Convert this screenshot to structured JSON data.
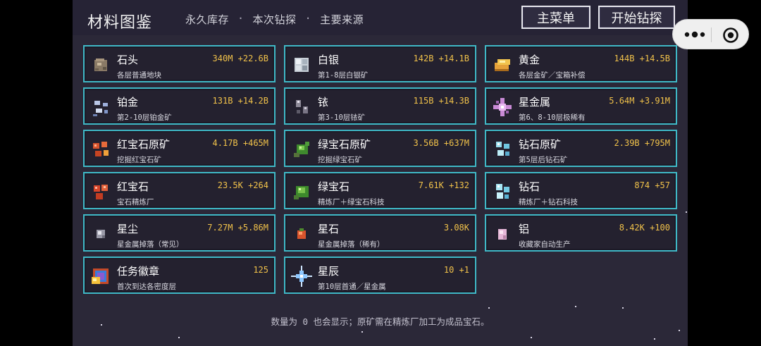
{
  "header": {
    "title": "材料图鉴",
    "tabs": [
      "永久库存",
      "本次钻探",
      "主要来源"
    ],
    "separator": "·",
    "main_menu_label": "主菜单",
    "start_drill_label": "开始钻探"
  },
  "materials": [
    {
      "name": "石头",
      "source": "各层普通地块",
      "value": "340M +22.6B",
      "icon": "stone-icon"
    },
    {
      "name": "白银",
      "source": "第1-8层白银矿",
      "value": "142B +14.1B",
      "icon": "silver-icon"
    },
    {
      "name": "黄金",
      "source": "各层金矿／宝箱补偿",
      "value": "144B +14.5B",
      "icon": "gold-icon"
    },
    {
      "name": "铂金",
      "source": "第2-10层铂金矿",
      "value": "131B +14.2B",
      "icon": "platinum-icon"
    },
    {
      "name": "铱",
      "source": "第3-10层铱矿",
      "value": "115B +14.3B",
      "icon": "iridium-icon"
    },
    {
      "name": "星金属",
      "source": "第6、8-10层极稀有",
      "value": "5.64M +3.91M",
      "icon": "star-metal-icon"
    },
    {
      "name": "红宝石原矿",
      "source": "挖掘红宝石矿",
      "value": "4.17B +465M",
      "icon": "ruby-ore-icon"
    },
    {
      "name": "绿宝石原矿",
      "source": "挖掘绿宝石矿",
      "value": "3.56B +637M",
      "icon": "emerald-ore-icon"
    },
    {
      "name": "钻石原矿",
      "source": "第5层后钻石矿",
      "value": "2.39B +795M",
      "icon": "diamond-ore-icon"
    },
    {
      "name": "红宝石",
      "source": "宝石精炼厂",
      "value": "23.5K +264",
      "icon": "ruby-icon"
    },
    {
      "name": "绿宝石",
      "source": "精炼厂＋绿宝石科技",
      "value": "7.61K +132",
      "icon": "emerald-icon"
    },
    {
      "name": "钻石",
      "source": "精炼厂＋钻石科技",
      "value": "874 +57",
      "icon": "diamond-icon"
    },
    {
      "name": "星尘",
      "source": "星金属掉落（常见）",
      "value": "7.27M +5.86M",
      "icon": "stardust-icon"
    },
    {
      "name": "星石",
      "source": "星金属掉落（稀有）",
      "value": "3.08K",
      "icon": "starstone-icon"
    },
    {
      "name": "铝",
      "source": "收藏家自动生产",
      "value": "8.42K +100",
      "icon": "aluminum-icon"
    },
    {
      "name": "任务徽章",
      "source": "首次到达各密度层",
      "value": "125",
      "icon": "badge-icon"
    },
    {
      "name": "星辰",
      "source": "第10层首通／星金属",
      "value": "10 +1",
      "icon": "star-icon"
    }
  ],
  "footer_note": "数量为 0 也会显示；原矿需在精炼厂加工为成品宝石。",
  "colors": {
    "card_border": "#3fb8c6",
    "value_text": "#f1c24a",
    "panel_bg": "#2b2838"
  }
}
